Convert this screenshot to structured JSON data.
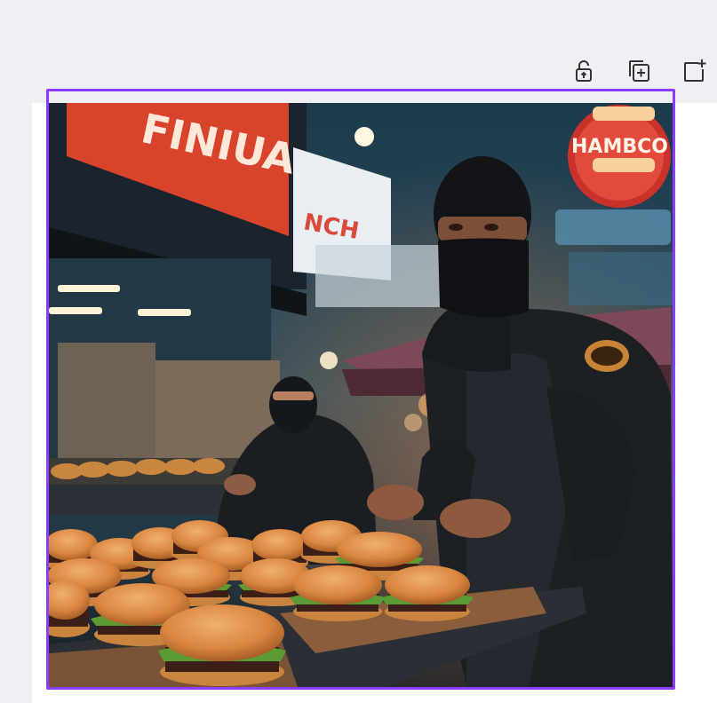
{
  "toolbar": {
    "lock_icon": "lock-icon",
    "duplicate_icon": "duplicate-page-icon",
    "add_page_icon": "add-page-icon"
  },
  "selection": {
    "color": "#8b3dff"
  },
  "photo": {
    "signs": {
      "left_sign": "FINIUA",
      "middle_sign": "NCH",
      "round_sign": "HAMBCO"
    }
  }
}
